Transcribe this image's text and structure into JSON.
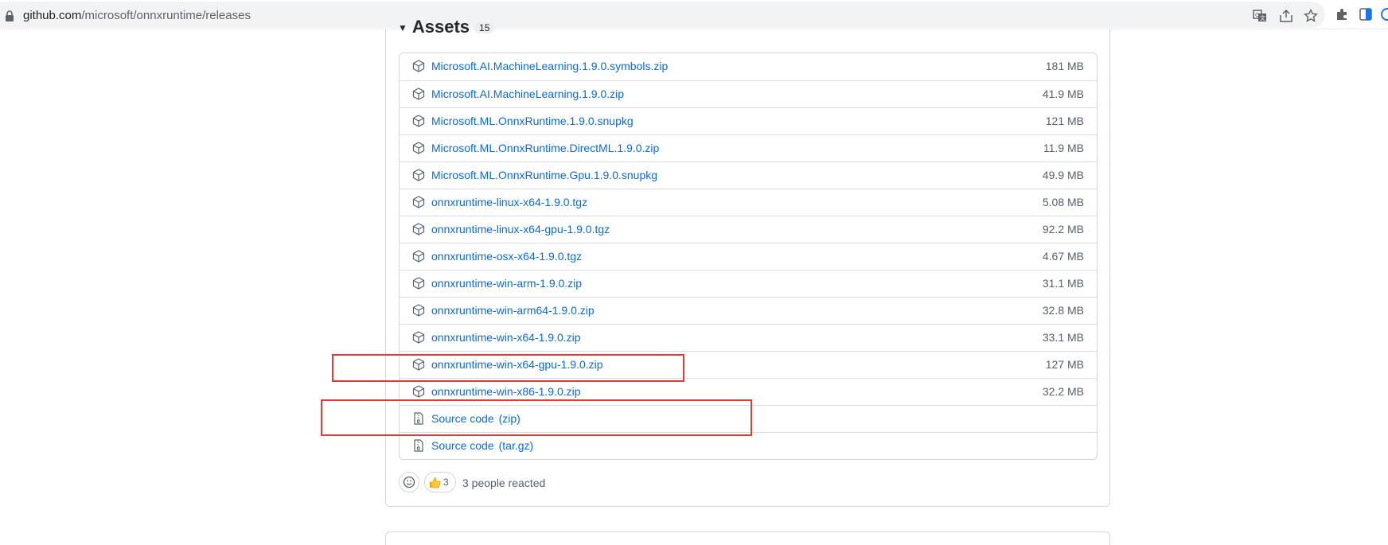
{
  "browser": {
    "url_host": "github.com",
    "url_path": "/microsoft/onnxruntime/releases"
  },
  "assets": {
    "heading": "Assets",
    "count": "15",
    "items": [
      {
        "name": "Microsoft.AI.MachineLearning.1.9.0.symbols.zip",
        "size": "181 MB",
        "icon": "package-icon"
      },
      {
        "name": "Microsoft.AI.MachineLearning.1.9.0.zip",
        "size": "41.9 MB",
        "icon": "package-icon"
      },
      {
        "name": "Microsoft.ML.OnnxRuntime.1.9.0.snupkg",
        "size": "121 MB",
        "icon": "package-icon"
      },
      {
        "name": "Microsoft.ML.OnnxRuntime.DirectML.1.9.0.zip",
        "size": "11.9 MB",
        "icon": "package-icon"
      },
      {
        "name": "Microsoft.ML.OnnxRuntime.Gpu.1.9.0.snupkg",
        "size": "49.9 MB",
        "icon": "package-icon"
      },
      {
        "name": "onnxruntime-linux-x64-1.9.0.tgz",
        "size": "5.08 MB",
        "icon": "package-icon"
      },
      {
        "name": "onnxruntime-linux-x64-gpu-1.9.0.tgz",
        "size": "92.2 MB",
        "icon": "package-icon"
      },
      {
        "name": "onnxruntime-osx-x64-1.9.0.tgz",
        "size": "4.67 MB",
        "icon": "package-icon"
      },
      {
        "name": "onnxruntime-win-arm-1.9.0.zip",
        "size": "31.1 MB",
        "icon": "package-icon"
      },
      {
        "name": "onnxruntime-win-arm64-1.9.0.zip",
        "size": "32.8 MB",
        "icon": "package-icon"
      },
      {
        "name": "onnxruntime-win-x64-1.9.0.zip",
        "size": "33.1 MB",
        "icon": "package-icon"
      },
      {
        "name": "onnxruntime-win-x64-gpu-1.9.0.zip",
        "size": "127 MB",
        "icon": "package-icon"
      },
      {
        "name": "onnxruntime-win-x86-1.9.0.zip",
        "size": "32.2 MB",
        "icon": "package-icon"
      }
    ],
    "source": [
      {
        "name": "Source code",
        "format": "(zip)",
        "icon": "file-zip-icon"
      },
      {
        "name": "Source code",
        "format": "(tar.gz)",
        "icon": "file-zip-icon"
      }
    ]
  },
  "reactions": {
    "thumbs_up_count": "3",
    "summary": "3 people reacted"
  },
  "colors": {
    "link": "#0969da",
    "annotation": "#e53935"
  }
}
